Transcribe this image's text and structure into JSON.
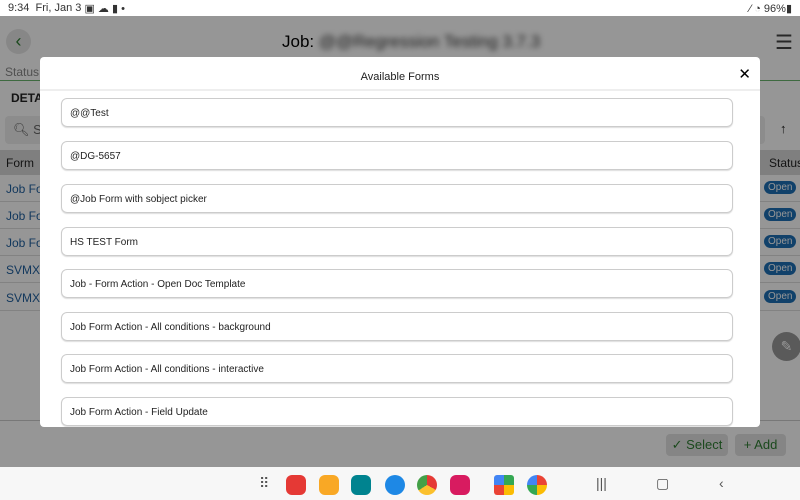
{
  "status_bar": {
    "time": "9:34",
    "date": "Fri, Jan 3",
    "battery": "96%"
  },
  "header": {
    "title_prefix": "Job:",
    "title_name": "@@Regression Testing 3.7.3"
  },
  "tabs": {
    "status": "Status"
  },
  "section": {
    "details": "DETA"
  },
  "search": {
    "placeholder": "S"
  },
  "table": {
    "headers": {
      "form": "Form",
      "status": "Status"
    },
    "rows": [
      {
        "name": "Job Fo",
        "status": "Open"
      },
      {
        "name": "Job Fo",
        "status": "Open"
      },
      {
        "name": "Job Fo",
        "status": "Open"
      },
      {
        "name": "SVMX",
        "status": "Open"
      },
      {
        "name": "SVMX",
        "status": "Open"
      }
    ]
  },
  "actions": {
    "select": "✓ Select",
    "add": "+ Add"
  },
  "modal": {
    "title": "Available Forms",
    "close": "✕",
    "items": [
      "@@Test",
      "@DG-5657",
      "@Job Form with sobject picker",
      "HS TEST Form",
      "Job - Form Action - Open Doc Template",
      "Job Form Action - All conditions - background",
      "Job Form Action - All conditions - interactive",
      "Job Form Action - Field Update"
    ]
  },
  "colors": {
    "accent": "#2e7d32",
    "badge": "#1e6fb5"
  }
}
